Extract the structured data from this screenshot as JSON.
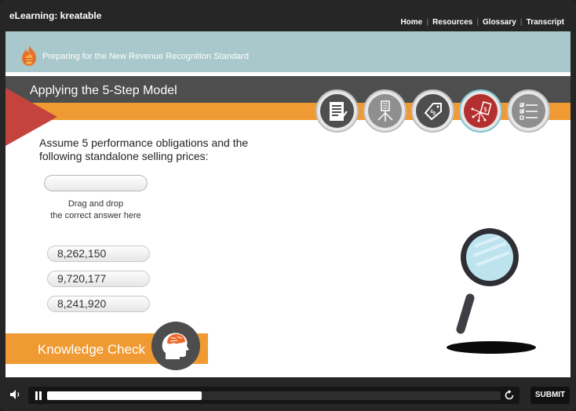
{
  "app": {
    "title": "eLearning: kreatable",
    "nav": [
      "Home",
      "Resources",
      "Glossary",
      "Transcript"
    ]
  },
  "slide": {
    "course_title": "Preparing for the New Revenue Recognition Standard",
    "section_title": "Applying the 5-Step Model",
    "step_icons": [
      {
        "name": "contract-document-icon",
        "active": false
      },
      {
        "name": "performance-obligations-icon",
        "active": false
      },
      {
        "name": "price-tag-icon",
        "active": false
      },
      {
        "name": "allocate-price-icon",
        "active": true
      },
      {
        "name": "checklist-icon",
        "active": false
      }
    ],
    "question": "Assume 5 performance obligations and the following standalone selling prices:",
    "drop_hint_line1": "Drag and drop",
    "drop_hint_line2": "the correct answer here",
    "answers": [
      "8,262,150",
      "9,720,177",
      "8,241,920"
    ],
    "knowledge_check": "Knowledge Check"
  },
  "controls": {
    "submit_label": "SUBMIT",
    "progress": 0.34
  },
  "colors": {
    "orange": "#ef9a32",
    "teal_band": "#a9c8cb",
    "red_accent": "#c4443d",
    "active_step": "#b4302f"
  }
}
